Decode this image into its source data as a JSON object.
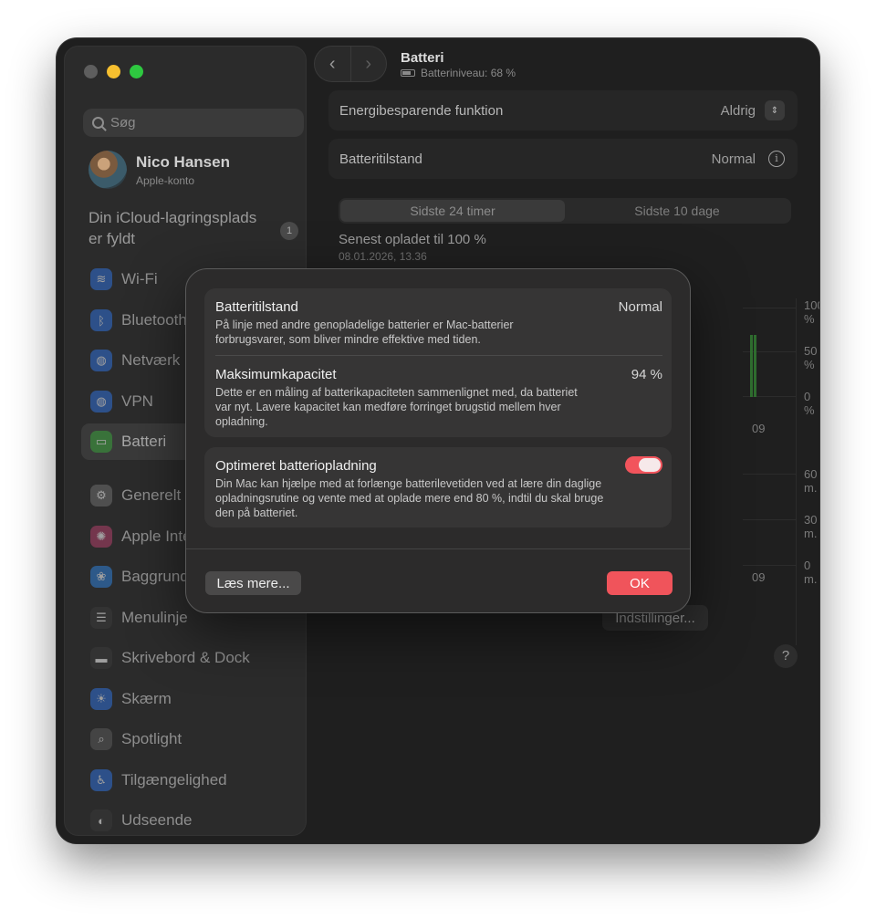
{
  "sidebar": {
    "search_placeholder": "Søg",
    "profile": {
      "name": "Nico Hansen",
      "sub": "Apple-konto"
    },
    "icloud": {
      "line1": "Din iCloud-lagringsplads",
      "line2": "er fyldt",
      "badge": "1"
    },
    "items": [
      {
        "label": "Wi-Fi",
        "icon": "wifi-icon",
        "glyph": "≋",
        "color": "#2f6fd6"
      },
      {
        "label": "Bluetooth",
        "icon": "bluetooth-icon",
        "glyph": "ᛒ",
        "color": "#2f6fd6"
      },
      {
        "label": "Netværk",
        "icon": "globe-icon",
        "glyph": "◍",
        "color": "#2f6fd6"
      },
      {
        "label": "VPN",
        "icon": "vpn-globe-icon",
        "glyph": "◍",
        "color": "#2f6fd6"
      },
      {
        "label": "Batteri",
        "icon": "battery-icon",
        "glyph": "▭",
        "color": "#39a13a"
      },
      {
        "label": "Generelt",
        "icon": "gear-icon",
        "glyph": "⚙",
        "color": "#6e6e6e"
      },
      {
        "label": "Apple Inte",
        "icon": "apple-intelligence-icon",
        "glyph": "✺",
        "color": "#b0406a"
      },
      {
        "label": "Baggrund",
        "icon": "wallpaper-icon",
        "glyph": "❀",
        "color": "#2f7fd6"
      },
      {
        "label": "Menulinje",
        "icon": "menubar-icon",
        "glyph": "☰",
        "color": "#3a3a3a"
      },
      {
        "label": "Skrivebord & Dock",
        "icon": "dock-icon",
        "glyph": "▬",
        "color": "#3a3a3a"
      },
      {
        "label": "Skærm",
        "icon": "display-icon",
        "glyph": "☀",
        "color": "#2f6fd6"
      },
      {
        "label": "Spotlight",
        "icon": "spotlight-icon",
        "glyph": "⌕",
        "color": "#5a5a5a"
      },
      {
        "label": "Tilgængelighed",
        "icon": "accessibility-icon",
        "glyph": "♿",
        "color": "#2f6fd6"
      },
      {
        "label": "Udseende",
        "icon": "appearance-icon",
        "glyph": "◐",
        "color": "#3a3a3a"
      }
    ]
  },
  "header": {
    "title": "Batteri",
    "subtitle": "Batteriniveau: 68 %"
  },
  "rows": {
    "energy": {
      "label": "Energibesparende funktion",
      "value": "Aldrig"
    },
    "health": {
      "label": "Batteritilstand",
      "value": "Normal"
    }
  },
  "segments": [
    "Sidste 24 timer",
    "Sidste 10 dage"
  ],
  "last_charged": {
    "label": "Senest opladet til 100 %",
    "date": "08.01.2026, 13.36"
  },
  "chart_labels": {
    "level": [
      "100 %",
      "50 %",
      "0 %"
    ],
    "usage": [
      "60 m.",
      "30 m.",
      "0 m."
    ],
    "x_top": "09",
    "x_bottom": "09"
  },
  "buttons": {
    "settings": "Indstillinger...",
    "help": "?"
  },
  "dialog": {
    "health_title": "Batteritilstand",
    "health_value": "Normal",
    "health_desc": "På linje med andre genopladelige batterier er Mac-batterier forbrugsvarer, som bliver mindre effektive med tiden.",
    "capacity_title": "Maksimumkapacitet",
    "capacity_value": "94 %",
    "capacity_desc": "Dette er en måling af batterikapaciteten sammenlignet med, da batteriet var nyt. Lavere kapacitet kan medføre forringet brugstid mellem hver opladning.",
    "optimized_title": "Optimeret batteriopladning",
    "optimized_desc": "Din Mac kan hjælpe med at forlænge batterilevetiden ved at lære din daglige opladningsrutine og vente med at oplade mere end 80 %, indtil du skal bruge den på batteriet.",
    "optimized_on": true,
    "more_button": "Læs mere...",
    "ok_button": "OK"
  }
}
